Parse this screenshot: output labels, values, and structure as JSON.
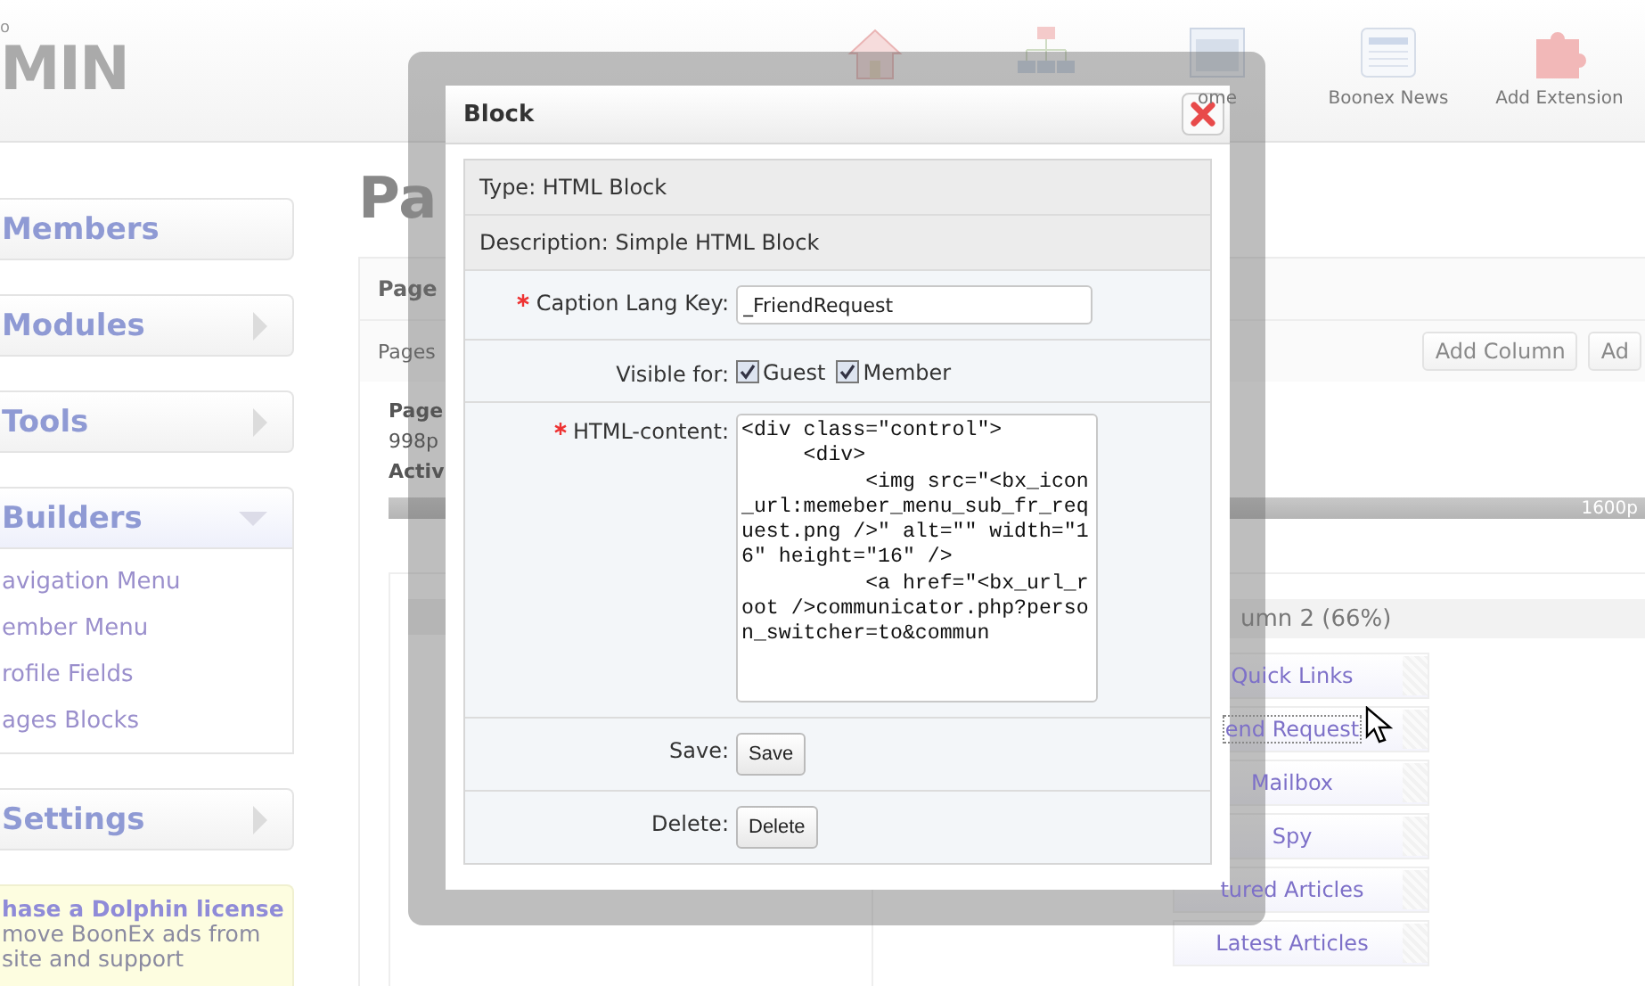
{
  "header": {
    "logo_small": "o",
    "logo": "MIN",
    "nav": [
      {
        "label": "ome"
      },
      {
        "label": "Boonex News"
      },
      {
        "label": "Add Extension"
      }
    ]
  },
  "sidebar": {
    "sections": [
      {
        "title": "Members",
        "expandable": false,
        "expanded": false
      },
      {
        "title": "Modules",
        "expandable": true,
        "expanded": false
      },
      {
        "title": "Tools",
        "expandable": true,
        "expanded": false
      },
      {
        "title": "Builders",
        "expandable": true,
        "expanded": true,
        "items": [
          "avigation Menu",
          "ember Menu",
          "rofile Fields",
          "ages Blocks"
        ]
      },
      {
        "title": "Settings",
        "expandable": true,
        "expanded": false
      }
    ],
    "promo": {
      "title": "hase a Dolphin license",
      "lines": [
        "move BoonEx ads from",
        "site and support"
      ]
    }
  },
  "main": {
    "title": "Pa",
    "panel": {
      "header": "Page",
      "tab": "Pages",
      "buttons": [
        "Add Column",
        "Ad"
      ],
      "info_label": "Page",
      "info_value": "998p",
      "active_label": "Activ",
      "width_label": "1600p",
      "column_header": "umn 2 (66%)",
      "blocks": [
        {
          "label": "Quick Links",
          "selected": false
        },
        {
          "label": "end Request",
          "selected": true
        },
        {
          "label": "Mailbox",
          "selected": false
        },
        {
          "label": "Spy",
          "selected": false
        },
        {
          "label": "tured Articles",
          "selected": false
        },
        {
          "label": "Latest Articles",
          "selected": false
        }
      ]
    }
  },
  "dialog": {
    "title": "Block",
    "type": "Type: HTML Block",
    "description": "Description: Simple HTML Block",
    "fields": [
      {
        "kind": "text",
        "label": "Caption Lang Key:",
        "required": true,
        "value": "_FriendRequest"
      },
      {
        "kind": "checkboxes",
        "label": "Visible for:",
        "required": false,
        "options": [
          {
            "label": "Guest",
            "checked": true
          },
          {
            "label": "Member",
            "checked": true
          }
        ]
      },
      {
        "kind": "textarea",
        "label": "HTML-content:",
        "required": true,
        "value": "<div class=\"control\">\n     <div>\n          <img src=\"<bx_icon_url:memeber_menu_sub_fr_request.png />\" alt=\"\" width=\"16\" height=\"16\" />\n          <a href=\"<bx_url_root />communicator.php?person_switcher=to&commun"
      },
      {
        "kind": "button",
        "label": "Save:",
        "required": false,
        "button": "Save"
      },
      {
        "kind": "button",
        "label": "Delete:",
        "required": false,
        "button": "Delete"
      }
    ]
  }
}
